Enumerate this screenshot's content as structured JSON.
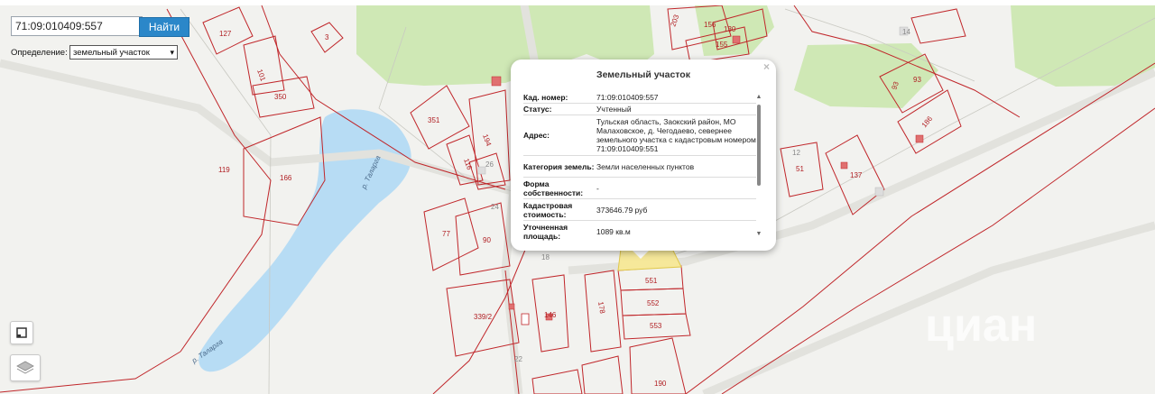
{
  "search": {
    "value": "71:09:010409:557",
    "button_label": "Найти"
  },
  "definition": {
    "label": "Определение:",
    "selected": "земельный участок"
  },
  "popup": {
    "title": "Земельный участок",
    "close_glyph": "×",
    "rows": [
      {
        "key": "Кад. номер:",
        "value": "71:09:010409:557"
      },
      {
        "key": "Статус:",
        "value": "Учтенный"
      },
      {
        "key": "Адрес:",
        "value": "Тульская область, Заокский район, МО Малаховское, д. Чегодаево, севернее земельного участка с кадастровым номером 71:09:010409:551"
      },
      {
        "key": "Категория земель:",
        "value": "Земли населенных пунктов"
      },
      {
        "key": "Форма собственности:",
        "value": "-"
      },
      {
        "key": "Кадастровая стоимость:",
        "value": "373646.79 руб"
      },
      {
        "key": "Уточненная площадь:",
        "value": "1089 кв.м"
      }
    ]
  },
  "map_labels": {
    "p127": "127",
    "p3": "3",
    "p101": "101",
    "p350": "350",
    "p351": "351",
    "p119": "119",
    "p166": "166",
    "p194": "194",
    "p116": "116",
    "p26": "26",
    "p24": "24",
    "p77": "77",
    "p90": "90",
    "p18": "18",
    "p551": "551",
    "p552": "552",
    "p553": "553",
    "p178": "178",
    "p146": "146",
    "p339": "339/2",
    "p190": "190",
    "p22": "22",
    "p203": "203",
    "p156": "156",
    "p130": "130",
    "p155": "155",
    "p14": "14",
    "p93a": "93",
    "p93b": "93",
    "p186": "186",
    "p51": "51",
    "p137": "137",
    "p12": "12",
    "river1": "р. Таларга",
    "river2": "р. Таларга",
    "watermark": "циан"
  },
  "colors": {
    "parcel_border": "#c0262a",
    "forest": "#cfe8b5",
    "water": "#b7dcf4",
    "selected_parcel": "#f6e89a",
    "button": "#2b87c9"
  },
  "icons": {
    "fullscreen": "fullscreen-icon",
    "layers": "layers-icon"
  }
}
